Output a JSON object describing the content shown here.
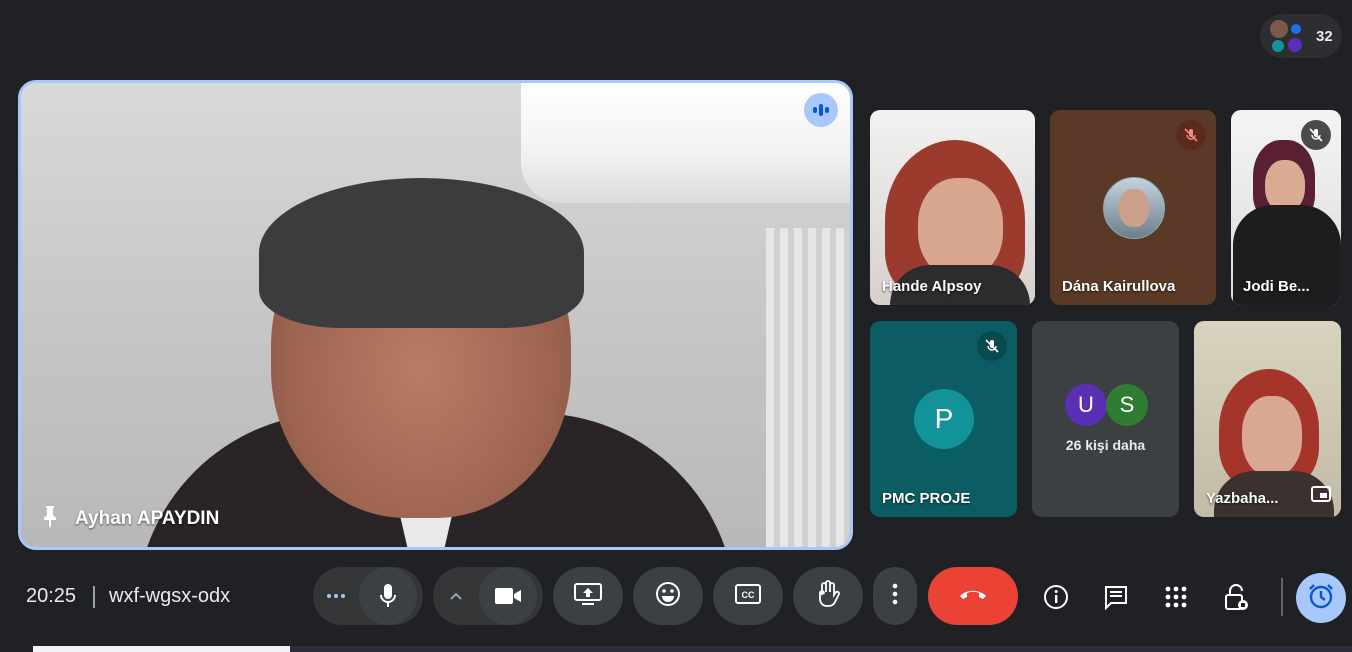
{
  "participants": {
    "count": "32"
  },
  "main_speaker": {
    "name": "Ayhan APAYDIN",
    "pin_icon": "pin-icon",
    "speaking_icon": "speaking-indicator-icon"
  },
  "tiles": [
    {
      "name": "Hande Alpsoy",
      "muted": false
    },
    {
      "name": "Dána Kairullova",
      "muted": true
    },
    {
      "name": "Jodi Be...",
      "muted": true
    },
    {
      "name": "PMC PROJE",
      "muted": true,
      "avatar_letter": "P",
      "avatar_color": "#12939a"
    },
    {
      "name": "26 kişi daha",
      "avatar_letters": [
        "U",
        "S"
      ],
      "avatar_colors": [
        "#5b2fb5",
        "#2f7d32"
      ]
    },
    {
      "name": "Yazbaha...",
      "muted": false
    }
  ],
  "meeting": {
    "time": "20:25",
    "code": "wxf-wgsx-odx"
  },
  "controls": {
    "more_options_icon": "more-horizontal-icon",
    "mic_icon": "microphone-icon",
    "camera_options_icon": "chevron-up-icon",
    "camera_icon": "video-camera-icon",
    "present_icon": "present-screen-icon",
    "reactions_icon": "emoji-icon",
    "captions_icon": "closed-captions-icon",
    "raise_hand_icon": "raise-hand-icon",
    "more_icon": "more-vertical-icon",
    "end_call_icon": "end-call-icon"
  },
  "right_controls": [
    "info-icon",
    "chat-icon",
    "activities-icon",
    "host-controls-icon",
    "timer-icon"
  ],
  "colors": {
    "accent": "#a8c7fa",
    "end_call": "#ea4335",
    "background": "#202124"
  }
}
